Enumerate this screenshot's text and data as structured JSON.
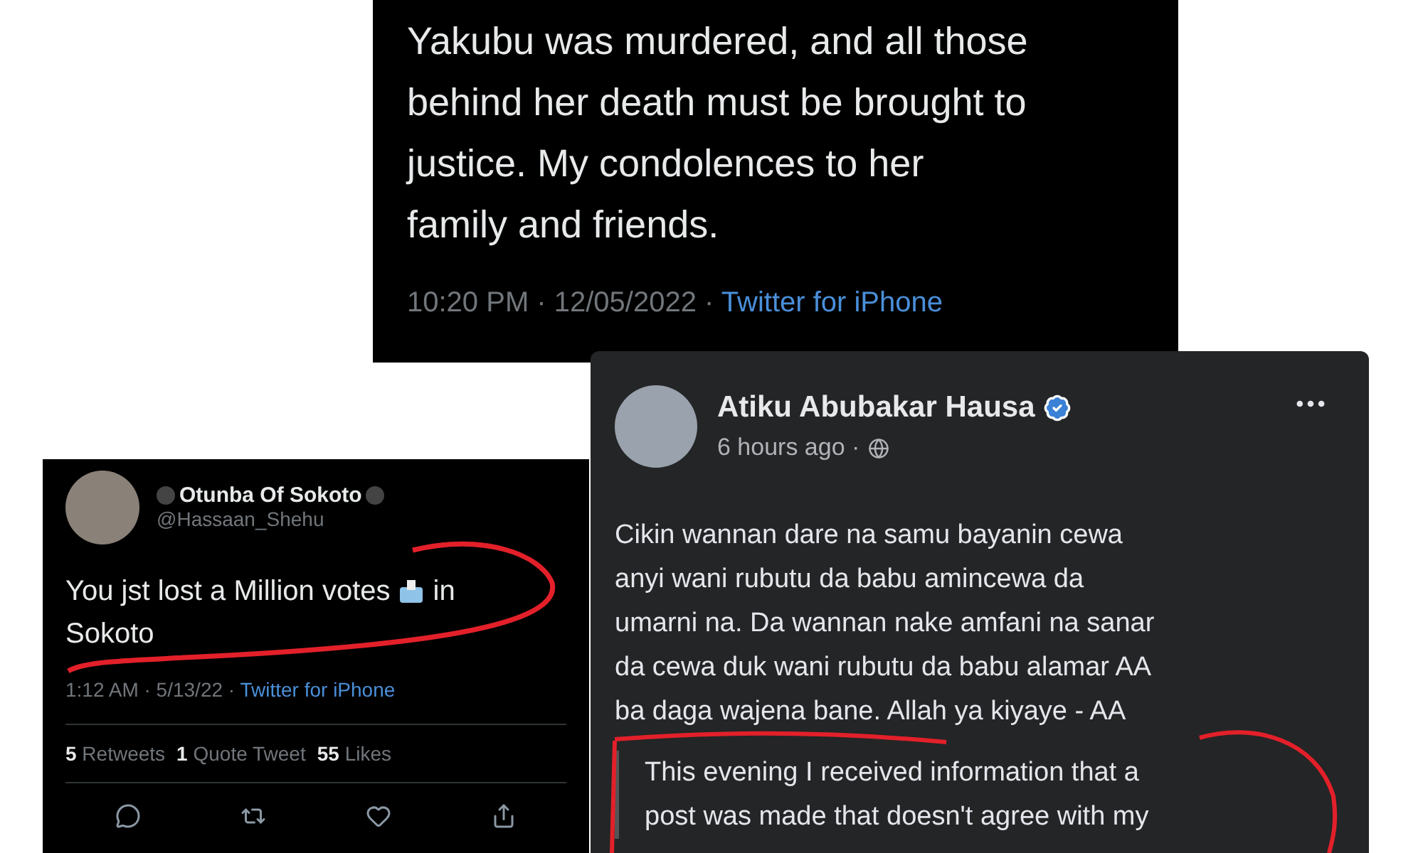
{
  "top_tweet": {
    "text": "Yakubu was murdered, and all those\nbehind her death must be brought to\njustice. My condolences to her\nfamily and friends.",
    "time": "10:20 PM · 12/05/2022 · ",
    "source": "Twitter for iPhone"
  },
  "reply_tweet": {
    "name": "Otunba Of Sokoto",
    "handle": "@Hassaan_Shehu",
    "text_before": "You jst lost a Million votes",
    "text_after": "in",
    "text_line2": "Sokoto",
    "time": "1:12 AM · 5/13/22 · ",
    "source": "Twitter for iPhone",
    "stats": [
      "**5** Retweets",
      "**1** Quote Tweet",
      "**55** Likes"
    ]
  },
  "facebook_post": {
    "name": "Atiku Abubakar Hausa",
    "verified": true,
    "time": "6 hours ago ·",
    "text": "Cikin wannan dare na samu bayanin cewa\nanyi wani rubutu da babu amincewa da\numarni na. Da wannan nake amfani na sanar\nda cewa duk wani rubutu da babu alamar AA\nba daga wajena bane. Allah ya kiyaye - AA",
    "quote": "This evening I received information that a\npost was made that doesn't agree with my"
  }
}
